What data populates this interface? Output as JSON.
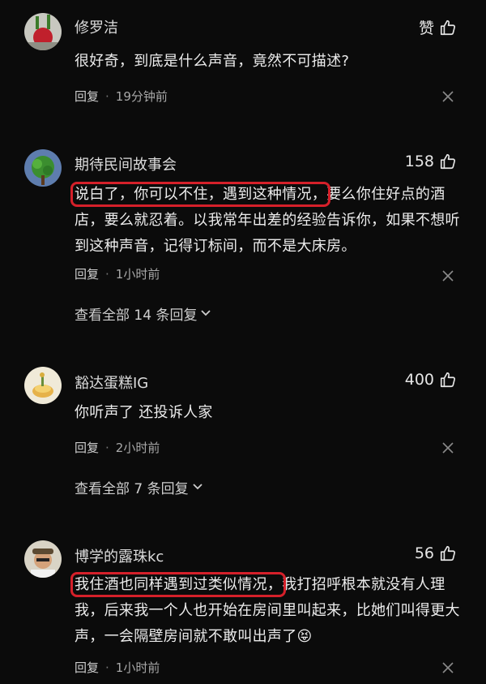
{
  "comments": [
    {
      "username": "修罗洁",
      "like_label": "赞",
      "text_plain": "很好奇，到底是什么声音，竟然不可描述?",
      "reply_label": "回复",
      "time": "19分钟前"
    },
    {
      "username": "期待民间故事会",
      "like_count": "158",
      "text_highlight": "说白了，你可以不住，遇到这种情况，",
      "text_rest": "要么你住好点的酒店，要么就忍着。以我常年出差的经验告诉你，如果不想听到这种声音，记得订标间，而不是大床房。",
      "reply_label": "回复",
      "time": "1小时前",
      "view_all": "查看全部 14 条回复"
    },
    {
      "username": "豁达蛋糕IG",
      "like_count": "400",
      "text_plain": "你听声了 还投诉人家",
      "reply_label": "回复",
      "time": "2小时前",
      "view_all": "查看全部 7 条回复"
    },
    {
      "username": "博学的露珠kc",
      "like_count": "56",
      "text_highlight": "我住酒也同样遇到过类似情况，",
      "text_rest": "我打招呼根本就没有人理我，后来我一个人也开始在房间里叫起来，比她们叫得更大声，一会隔壁房间就不敢叫出声了",
      "emoji": "😝",
      "reply_label": "回复",
      "time": "1小时前"
    }
  ],
  "icons": {
    "like": "thumbs-up-icon",
    "close": "close-icon",
    "expand": "chevron-down-icon"
  },
  "colors": {
    "background": "#0b0b0b",
    "highlight_border": "#d5202a"
  }
}
